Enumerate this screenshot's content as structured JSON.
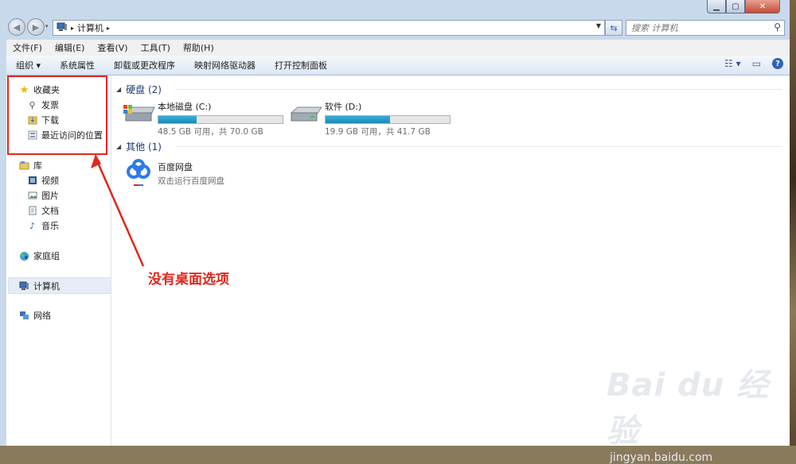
{
  "address": {
    "crumb": "计算机",
    "search_placeholder": "搜索 计算机"
  },
  "menu": [
    "文件(F)",
    "编辑(E)",
    "查看(V)",
    "工具(T)",
    "帮助(H)"
  ],
  "commands": [
    "组织 ▾",
    "系统属性",
    "卸载或更改程序",
    "映射网络驱动器",
    "打开控制面板"
  ],
  "nav": {
    "favorites": "收藏夹",
    "fav_items": [
      "发票",
      "下载",
      "最近访问的位置"
    ],
    "libraries": "库",
    "lib_items": [
      "视频",
      "图片",
      "文档",
      "音乐"
    ],
    "homegroup": "家庭组",
    "computer": "计算机",
    "network": "网络"
  },
  "groups": {
    "hdd": "硬盘 (2)",
    "other": "其他 (1)"
  },
  "drives": [
    {
      "name": "本地磁盘 (C:)",
      "size": "48.5 GB 可用，共 70.0 GB",
      "used_fraction": 0.31
    },
    {
      "name": "软件 (D:)",
      "size": "19.9 GB 可用，共 41.7 GB",
      "used_fraction": 0.52
    }
  ],
  "other_item": {
    "name": "百度网盘",
    "desc": "双击运行百度网盘"
  },
  "annotation": "没有桌面选项",
  "watermark": {
    "line1": "Bai du 经验",
    "line2": "jingyan.baidu.com"
  },
  "colors": {
    "accent": "#2a64b8",
    "annotation": "#e2261b",
    "bar": "#1f88b5"
  }
}
